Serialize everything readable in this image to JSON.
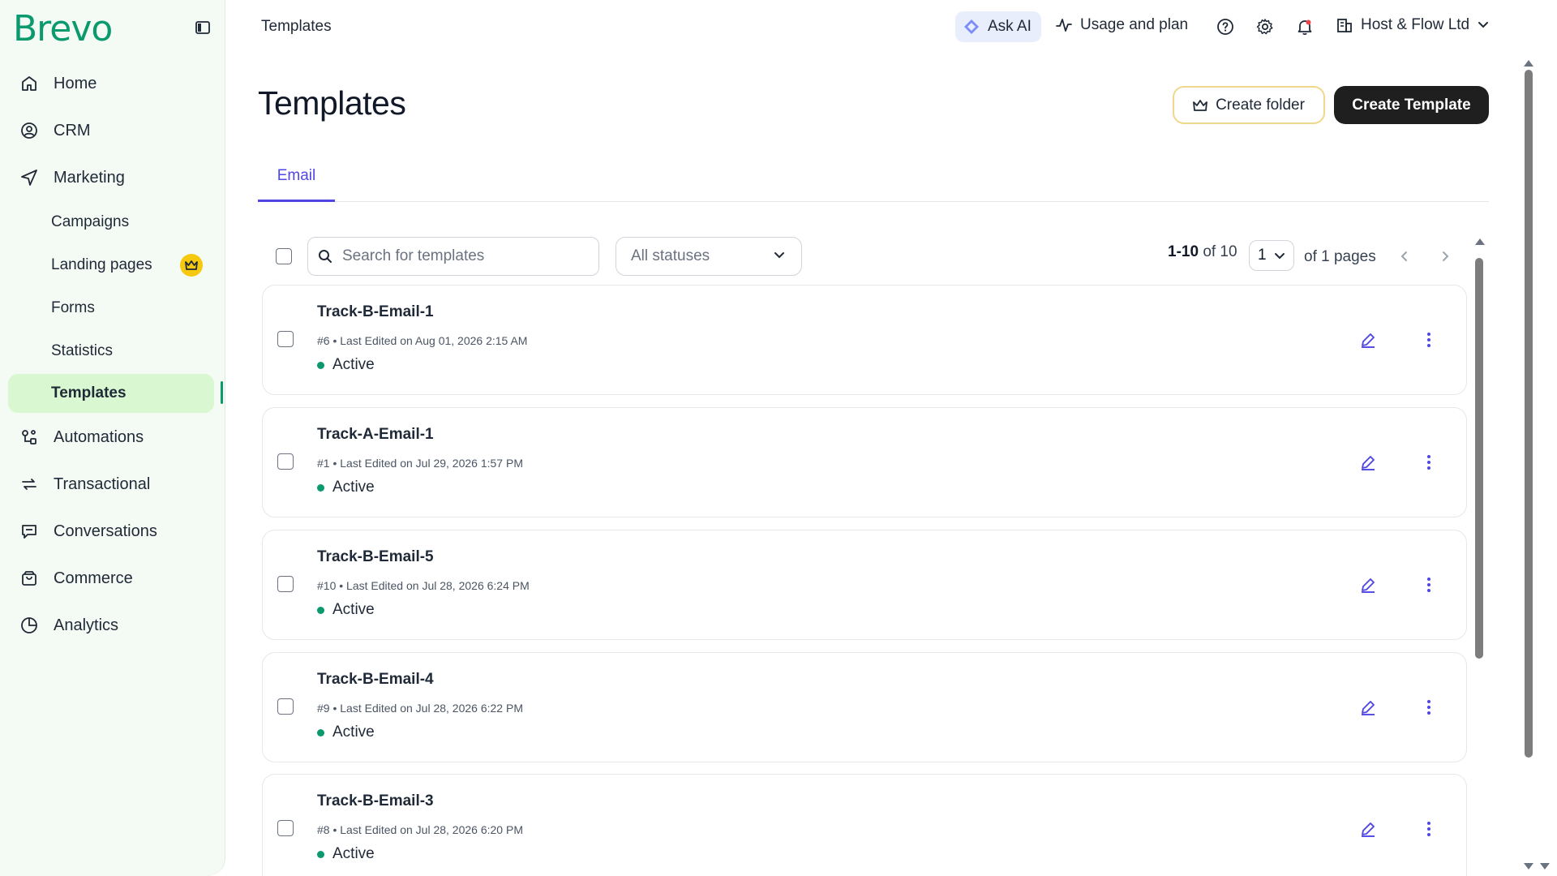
{
  "app": {
    "logo": "Brevo",
    "accent": "#0b996e",
    "link_color": "#4f46e5"
  },
  "sidebar": {
    "items": [
      {
        "label": "Home",
        "icon": "home-icon"
      },
      {
        "label": "CRM",
        "icon": "user-circle-icon"
      },
      {
        "label": "Marketing",
        "icon": "send-icon"
      },
      {
        "label": "Automations",
        "icon": "automation-icon"
      },
      {
        "label": "Transactional",
        "icon": "repeat-icon"
      },
      {
        "label": "Conversations",
        "icon": "chat-icon"
      },
      {
        "label": "Commerce",
        "icon": "shopping-bag-icon"
      },
      {
        "label": "Analytics",
        "icon": "pie-chart-icon"
      }
    ],
    "marketing_sub": [
      {
        "label": "Campaigns"
      },
      {
        "label": "Landing pages",
        "badge": "crown-icon"
      },
      {
        "label": "Forms"
      },
      {
        "label": "Statistics"
      },
      {
        "label": "Templates",
        "active": true
      }
    ]
  },
  "topbar": {
    "title": "Templates",
    "ask_ai": "Ask AI",
    "usage": "Usage and plan",
    "account": "Host & Flow Ltd"
  },
  "page": {
    "title": "Templates",
    "create_folder": "Create folder",
    "create_template": "Create Template",
    "tabs": [
      {
        "label": "Email",
        "active": true
      }
    ]
  },
  "toolbar": {
    "search_placeholder": "Search for templates",
    "status_filter": "All statuses",
    "range": "1-10",
    "of_total": "of 10",
    "page": "1",
    "of_pages": "of 1 pages"
  },
  "templates": [
    {
      "name": "Track-B-Email-1",
      "id": "#6",
      "edited": "Last Edited on Aug 01, 2026 2:15 AM",
      "status": "Active"
    },
    {
      "name": "Track-A-Email-1",
      "id": "#1",
      "edited": "Last Edited on Jul 29, 2026 1:57 PM",
      "status": "Active"
    },
    {
      "name": "Track-B-Email-5",
      "id": "#10",
      "edited": "Last Edited on Jul 28, 2026 6:24 PM",
      "status": "Active"
    },
    {
      "name": "Track-B-Email-4",
      "id": "#9",
      "edited": "Last Edited on Jul 28, 2026 6:22 PM",
      "status": "Active"
    },
    {
      "name": "Track-B-Email-3",
      "id": "#8",
      "edited": "Last Edited on Jul 28, 2026 6:20 PM",
      "status": "Active"
    }
  ]
}
